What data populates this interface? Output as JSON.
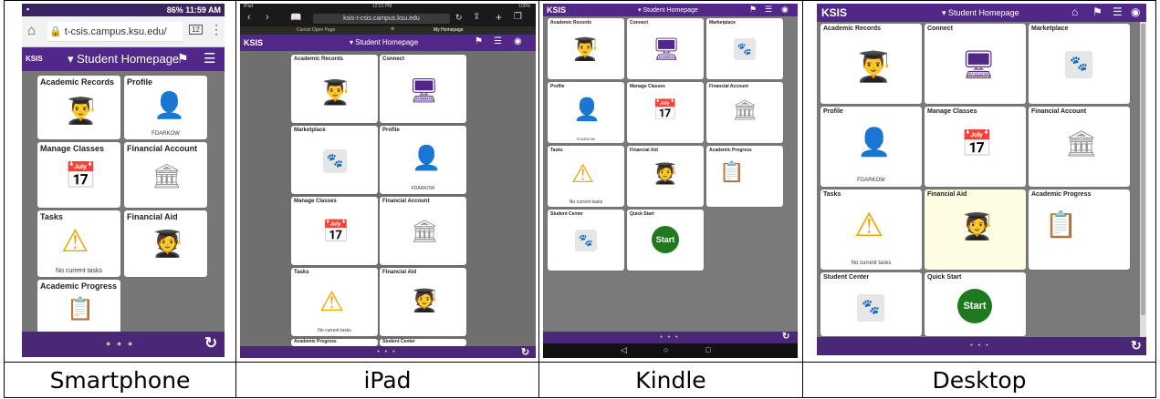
{
  "captions": [
    "Smartphone",
    "iPad",
    "Kindle",
    "Desktop"
  ],
  "app": {
    "logo": "KSIS",
    "homepage": "Student Homepage"
  },
  "colors": {
    "brand": "#512888",
    "page_bg": "#777777",
    "tile_bg": "#ffffff",
    "warn": "#f5a300",
    "start": "#1f7a1f"
  },
  "tiles": {
    "academic_records": "Academic Records",
    "profile": "Profile",
    "profile_name": "FDARKOW",
    "manage_classes": "Manage Classes",
    "financial_account": "Financial Account",
    "tasks": "Tasks",
    "no_tasks": "No current tasks",
    "financial_aid": "Financial Aid",
    "academic_progress": "Academic Progress",
    "connect": "Connect",
    "marketplace": "Marketplace",
    "student_center": "Student Center",
    "quick_start": "Quick Start",
    "start_label": "Start"
  },
  "smartphone": {
    "status_right": "86% 11:59 AM",
    "url": "t-csis.campus.ksu.edu/",
    "tab_count": "12"
  },
  "ipad": {
    "status_left": "iPad",
    "time": "12:51 PM",
    "battery": "100%",
    "url": "ksis-t-csis.campus.ksu.edu",
    "tab_left": "Cancel Open Page",
    "tab_right": "My Homepage"
  },
  "icons": {
    "home": "home-icon",
    "flag": "flag-icon",
    "menu": "hamburger-icon",
    "nav": "compass-icon",
    "refresh": "refresh-icon"
  }
}
